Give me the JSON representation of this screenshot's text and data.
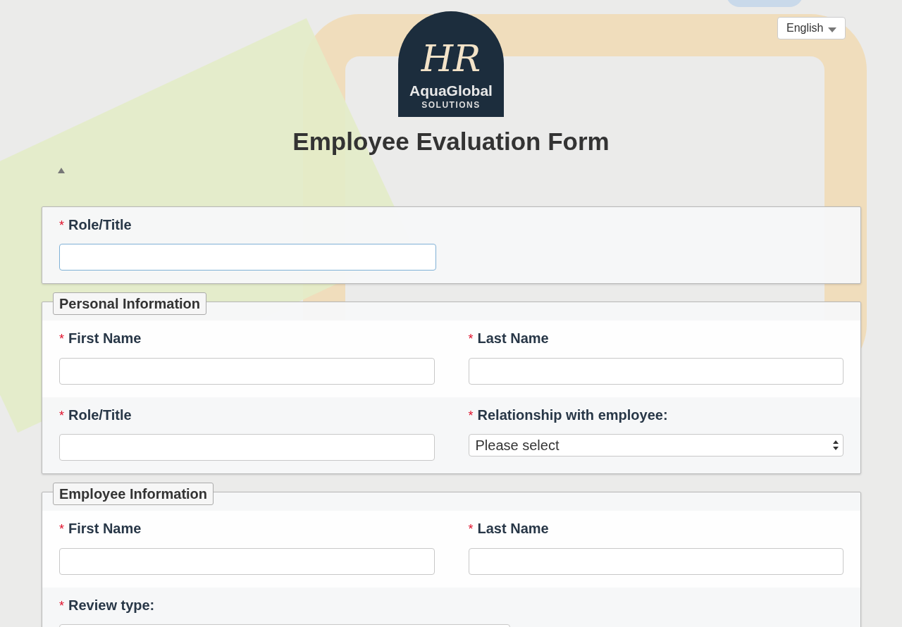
{
  "language": {
    "value": "English"
  },
  "logo": {
    "monogram": "HR",
    "name": "AquaGlobal",
    "tagline": "SOLUTIONS"
  },
  "title": "Employee Evaluation Form",
  "sections": [
    {
      "rows": [
        {
          "fields": [
            {
              "label": "Role/Title",
              "marker": "*",
              "kind": "text",
              "focused": true
            }
          ]
        }
      ]
    },
    {
      "legend": "Personal Information",
      "rows": [
        {
          "fields": [
            {
              "label": "First Name",
              "marker": "*",
              "kind": "text",
              "focused": false
            },
            {
              "label": "Last Name",
              "marker": "*",
              "kind": "text",
              "focused": false
            }
          ]
        },
        {
          "fields": [
            {
              "label": "Role/Title",
              "marker": "*",
              "kind": "text",
              "focused": false
            },
            {
              "label": "Relationship with employee:",
              "marker": "*",
              "kind": "select",
              "value": "Please select",
              "focused": false
            }
          ]
        }
      ]
    },
    {
      "legend": "Employee Information",
      "rows": [
        {
          "fields": [
            {
              "label": "First Name",
              "marker": "*",
              "kind": "text",
              "focused": false
            },
            {
              "label": "Last Name",
              "marker": "*",
              "kind": "text",
              "focused": false
            }
          ]
        },
        {
          "fields": [
            {
              "label": "Review type:",
              "marker": "*",
              "kind": "box",
              "focused": false
            }
          ]
        }
      ]
    }
  ]
}
